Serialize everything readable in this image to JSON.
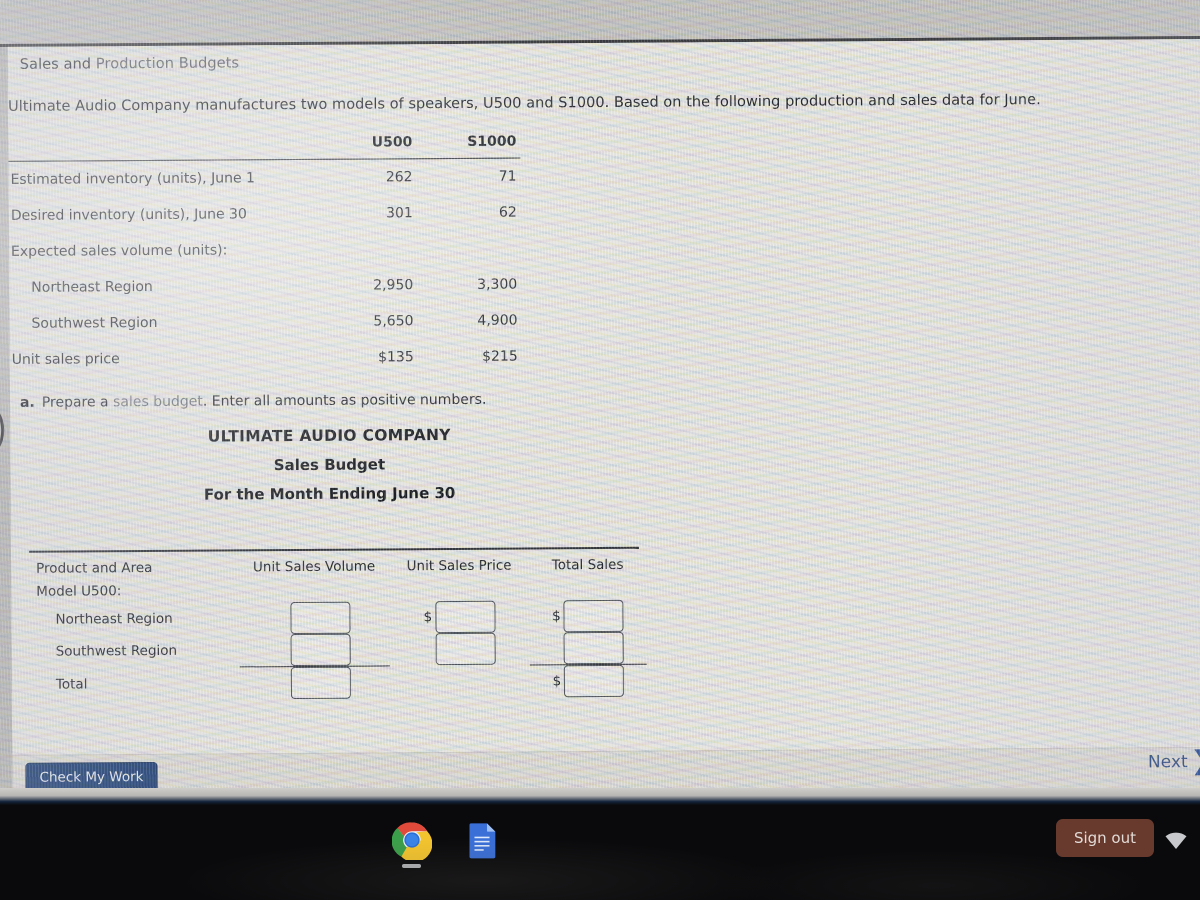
{
  "question": {
    "title_plain": "Sales and ",
    "title_muted": "Production Budgets",
    "intro": "Ultimate Audio Company manufactures two models of speakers, U500 and S1000. Based on the following production and sales data for June."
  },
  "data_table": {
    "headers": [
      "",
      "U500",
      "S1000"
    ],
    "rows": [
      {
        "label": "Estimated inventory (units), June 1",
        "indent": false,
        "u500": "262",
        "s1000": "71"
      },
      {
        "label": "Desired inventory (units), June 30",
        "indent": false,
        "u500": "301",
        "s1000": "62"
      },
      {
        "label": "Expected sales volume (units):",
        "indent": false,
        "u500": "",
        "s1000": ""
      },
      {
        "label": "Northeast Region",
        "indent": true,
        "u500": "2,950",
        "s1000": "3,300"
      },
      {
        "label": "Southwest Region",
        "indent": true,
        "u500": "5,650",
        "s1000": "4,900"
      },
      {
        "label": "Unit sales price",
        "indent": false,
        "u500": "$135",
        "s1000": "$215"
      }
    ]
  },
  "part_a": {
    "letter": "a.",
    "text_before": "Prepare a ",
    "link_text": "sales budget",
    "text_after": ". Enter all amounts as positive numbers."
  },
  "statement": {
    "company": "ULTIMATE AUDIO COMPANY",
    "name": "Sales Budget",
    "period": "For the Month Ending June 30"
  },
  "budget_form": {
    "columns": [
      "Product and Area",
      "Unit Sales Volume",
      "Unit Sales Price",
      "Total Sales"
    ],
    "rows": [
      {
        "label": "Model U500:",
        "indent": false,
        "type": "section",
        "volume_input": false,
        "price_input": false,
        "price_dollar": false,
        "total_input": false,
        "total_dollar": false
      },
      {
        "label": "Northeast Region",
        "indent": true,
        "type": "entry",
        "volume_input": true,
        "price_input": true,
        "price_dollar": true,
        "total_input": true,
        "total_dollar": true
      },
      {
        "label": "Southwest Region",
        "indent": true,
        "type": "entry",
        "volume_input": true,
        "price_input": true,
        "price_dollar": false,
        "total_input": true,
        "total_dollar": false
      },
      {
        "label": "Total",
        "indent": true,
        "type": "total",
        "volume_input": true,
        "price_input": false,
        "price_dollar": false,
        "total_input": true,
        "total_dollar": true
      }
    ],
    "currency_symbol": "$",
    "input_value": ""
  },
  "toolbar": {
    "check_label": "Check My Work",
    "next_label": "Next",
    "next_chevron": "❯"
  },
  "shelf": {
    "signout_label": "Sign out",
    "icons": [
      "chrome-icon",
      "docs-icon",
      "wifi-icon"
    ]
  },
  "colors": {
    "check_button_bg": "#1b3e74",
    "next_text": "#1f3f78",
    "signout_bg": "#6d3d2f",
    "page_bg": "#e9e8e4",
    "shelf_bg": "#0a0a0c",
    "rule": "#2f3238"
  }
}
